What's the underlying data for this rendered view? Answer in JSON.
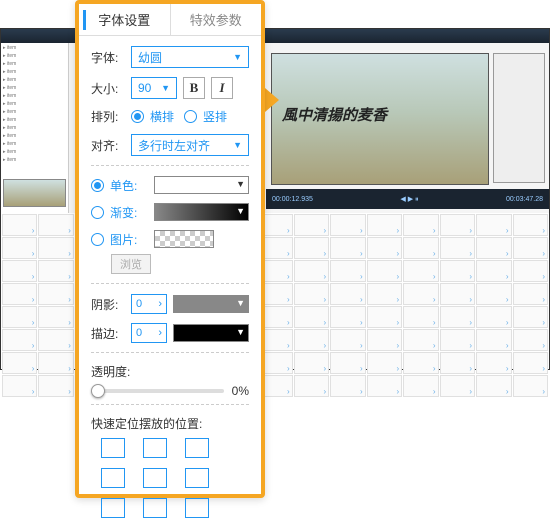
{
  "tabs": {
    "font": "字体设置",
    "fx": "特效参数"
  },
  "labels": {
    "font": "字体:",
    "size": "大小:",
    "align": "排列:",
    "justify": "对齐:",
    "solid": "单色:",
    "gradient": "渐变:",
    "image": "图片:",
    "browse": "浏览",
    "shadow": "阴影:",
    "stroke": "描边:",
    "opacity": "透明度:",
    "quickpos": "快速定位摆放的位置:",
    "horiz": "横排",
    "vert": "竖排"
  },
  "values": {
    "font": "幼圆",
    "size": "90",
    "justify": "多行时左对齐",
    "shadow": "0",
    "stroke": "0",
    "opacity": "0%"
  },
  "preview_text": "風中清揚的麦香",
  "time": {
    "cur": "00:00:12.935",
    "dur": "00:03:47.28"
  }
}
